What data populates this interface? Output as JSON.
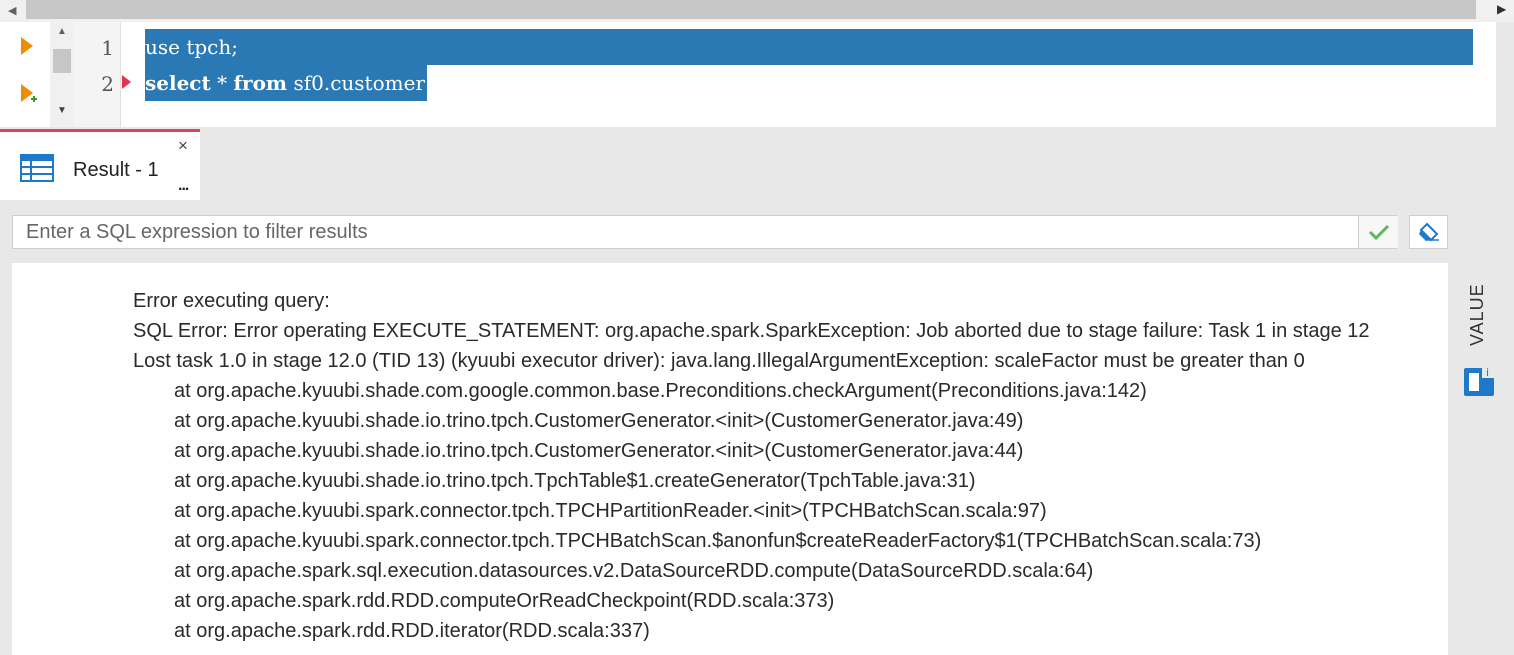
{
  "editor": {
    "lines": [
      {
        "number": "1",
        "text": "use tpch;"
      },
      {
        "number": "2",
        "keyword1": "select",
        "mid": " * ",
        "keyword2": "from",
        "rest": " sf0.customer"
      }
    ]
  },
  "results": {
    "tab_label": "Result - 1",
    "tab_more": "...",
    "tab_close": "×"
  },
  "filter": {
    "placeholder": "Enter a SQL expression to filter results"
  },
  "side_panel": {
    "label": "VALUE"
  },
  "error": {
    "lines": [
      "Error executing query:",
      "SQL Error: Error operating EXECUTE_STATEMENT: org.apache.spark.SparkException: Job aborted due to stage failure: Task 1 in stage 12",
      "Lost task 1.0 in stage 12.0 (TID 13) (kyuubi executor driver): java.lang.IllegalArgumentException: scaleFactor must be greater than 0",
      "at org.apache.kyuubi.shade.com.google.common.base.Preconditions.checkArgument(Preconditions.java:142)",
      "at org.apache.kyuubi.shade.io.trino.tpch.CustomerGenerator.<init>(CustomerGenerator.java:49)",
      "at org.apache.kyuubi.shade.io.trino.tpch.CustomerGenerator.<init>(CustomerGenerator.java:44)",
      "at org.apache.kyuubi.shade.io.trino.tpch.TpchTable$1.createGenerator(TpchTable.java:31)",
      "at org.apache.kyuubi.spark.connector.tpch.TPCHPartitionReader.<init>(TPCHBatchScan.scala:97)",
      "at org.apache.kyuubi.spark.connector.tpch.TPCHBatchScan.$anonfun$createReaderFactory$1(TPCHBatchScan.scala:73)",
      "at org.apache.spark.sql.execution.datasources.v2.DataSourceRDD.compute(DataSourceRDD.scala:64)",
      "at org.apache.spark.rdd.RDD.computeOrReadCheckpoint(RDD.scala:373)",
      "at org.apache.spark.rdd.RDD.iterator(RDD.scala:337)"
    ]
  },
  "colors": {
    "selection": "#2a79b5",
    "accent_tab": "#d9445a",
    "run_icon": "#f08c00",
    "apply_check": "#5cb85c",
    "brand_blue": "#1e7ac8"
  },
  "icons": {
    "run": "play-triangle-icon",
    "run_new": "play-add-icon",
    "grid": "table-grid-icon",
    "apply": "check-icon",
    "clear": "eraser-icon",
    "value": "value-panel-icon"
  }
}
